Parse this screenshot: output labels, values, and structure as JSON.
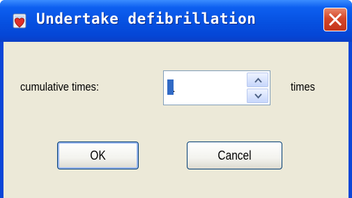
{
  "window": {
    "title": "Undertake defibrillation",
    "title_icon": "defibrillator-icon",
    "close_icon": "close-icon"
  },
  "form": {
    "cumulative_label": "cumulative times:",
    "cumulative_value": "1",
    "unit_label": "times",
    "spin_up_icon": "chevron-up-icon",
    "spin_down_icon": "chevron-down-icon"
  },
  "buttons": {
    "ok_label": "OK",
    "cancel_label": "Cancel"
  },
  "colors": {
    "titlebar": "#0650e0",
    "close_button": "#d5472a",
    "client_background": "#ece9d8",
    "selection": "#316ac5"
  }
}
